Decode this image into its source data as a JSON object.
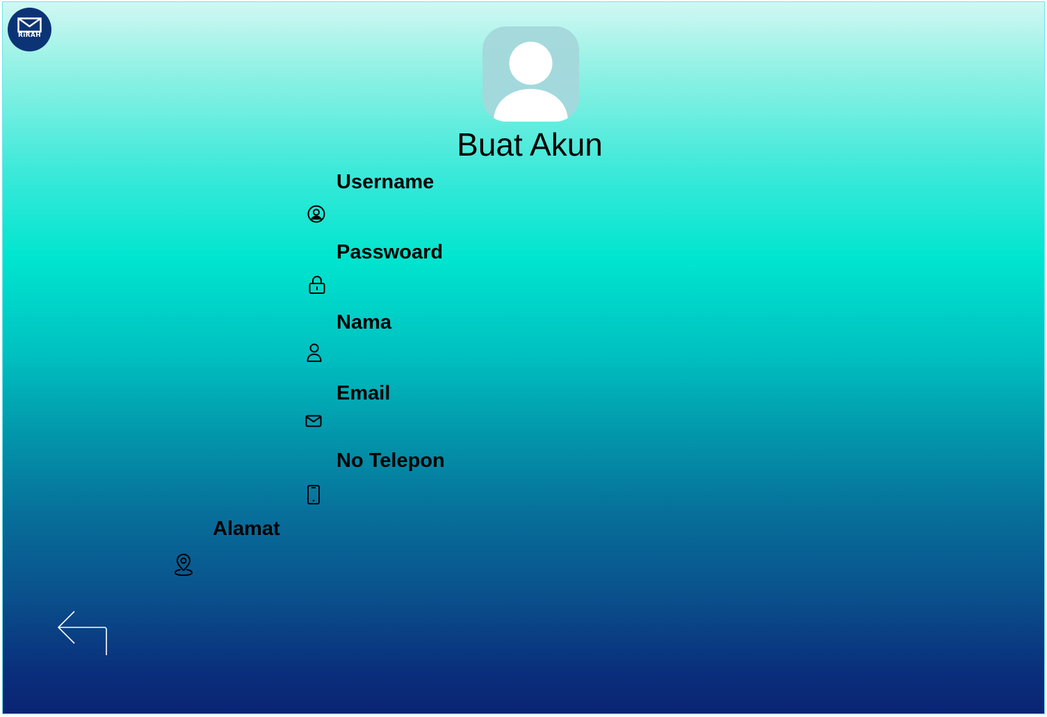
{
  "app": {
    "logo_text": "RiRAH",
    "logo_icon": "envelope-icon"
  },
  "profile": {
    "avatar_icon": "user-avatar-icon"
  },
  "form": {
    "title": "Buat Akun",
    "fields": [
      {
        "label": "Username",
        "icon": "user-circle-icon",
        "value": ""
      },
      {
        "label": "Passwoard",
        "icon": "lock-icon",
        "value": ""
      },
      {
        "label": "Nama",
        "icon": "person-icon",
        "value": ""
      },
      {
        "label": "Email",
        "icon": "mail-icon",
        "value": ""
      },
      {
        "label": "No Telepon",
        "icon": "smartphone-icon",
        "value": ""
      },
      {
        "label": "Alamat",
        "icon": "map-pin-icon",
        "value": ""
      }
    ]
  },
  "navigation": {
    "back_icon": "back-arrow-icon"
  },
  "colors": {
    "gradient_top": "#d2f7f3",
    "gradient_mid": "#00e5cf",
    "gradient_bottom": "#0a2474",
    "logo_bg": "#0c3475",
    "avatar_bg": "#a4d7db"
  }
}
